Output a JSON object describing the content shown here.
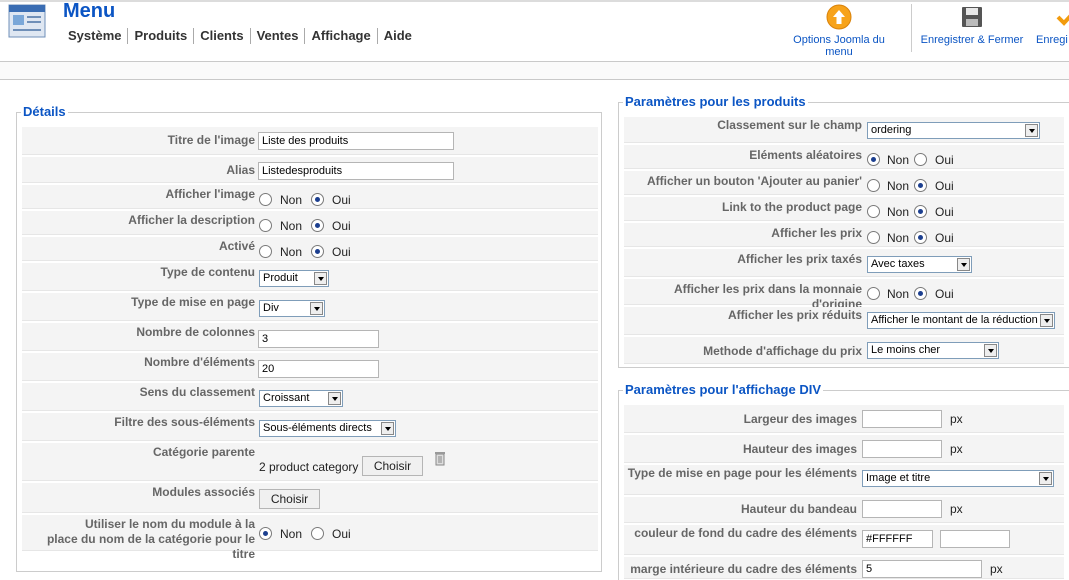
{
  "header": {
    "title": "Menu",
    "menubar": [
      "Système",
      "Produits",
      "Clients",
      "Ventes",
      "Affichage",
      "Aide"
    ]
  },
  "toolbar": {
    "options_label": "Options Joomla du menu",
    "save_close_label": "Enregistrer & Fermer",
    "save_label": "Enregi"
  },
  "details": {
    "legend": "Détails",
    "fields": {
      "titre_label": "Titre de l'image",
      "titre_value": "Liste des produits",
      "alias_label": "Alias",
      "alias_value": "Listedesproduits",
      "afficher_image_label": "Afficher l'image",
      "afficher_desc_label": "Afficher la description",
      "active_label": "Activé",
      "type_contenu_label": "Type de contenu",
      "type_contenu_value": "Produit",
      "type_mise_label": "Type de mise en page",
      "type_mise_value": "Div",
      "nb_colonnes_label": "Nombre de colonnes",
      "nb_colonnes_value": "3",
      "nb_elements_label": "Nombre d'éléments",
      "nb_elements_value": "20",
      "sens_label": "Sens du classement",
      "sens_value": "Croissant",
      "filtre_label": "Filtre des sous-éléments",
      "filtre_value": "Sous-éléments directs",
      "categorie_label": "Catégorie parente",
      "categorie_value": "2 product category",
      "modules_label": "Modules associés",
      "utiliser_label_1": "Utiliser le nom du module à la",
      "utiliser_label_2": "place du nom de la catégorie pour le titre"
    },
    "non": "Non",
    "oui": "Oui",
    "choisir": "Choisir"
  },
  "produits": {
    "legend": "Paramètres pour les produits",
    "classement_label": "Classement sur le champ",
    "classement_value": "ordering",
    "aleatoires_label": "Eléments aléatoires",
    "ajouter_label": "Afficher un bouton 'Ajouter au panier'",
    "link_label": "Link to the product page",
    "prix_label": "Afficher les prix",
    "prix_taxes_label": "Afficher les prix taxés",
    "prix_taxes_value": "Avec taxes",
    "monnaie_label": "Afficher les prix dans la monnaie d'origine",
    "reduits_label": "Afficher les prix réduits",
    "reduits_value": "Afficher le montant de la réduction",
    "methode_label": "Methode d'affichage du prix",
    "methode_value": "Le moins cher"
  },
  "div": {
    "legend": "Paramètres pour l'affichage DIV",
    "largeur_label": "Largeur des images",
    "hauteur_label": "Hauteur des images",
    "type_label": "Type de mise en page pour les éléments",
    "type_value": "Image et titre",
    "bandeau_label": "Hauteur du bandeau",
    "couleur_label": "couleur de fond du cadre des éléments",
    "couleur_value": "#FFFFFF",
    "marge_label": "marge intérieure du cadre des éléments",
    "marge_value": "5",
    "px": "px"
  },
  "colors": {
    "accent": "#0b55c4",
    "row_bg": "#f4f4f4"
  }
}
